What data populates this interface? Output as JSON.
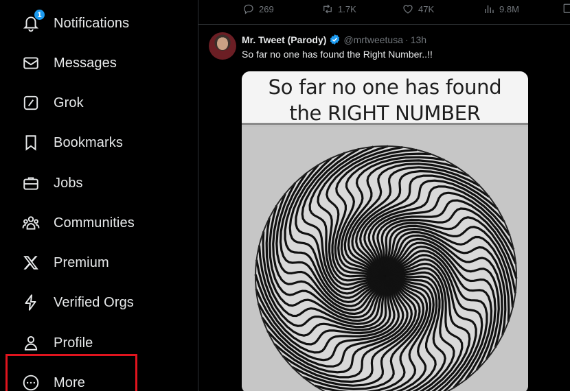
{
  "sidebar": {
    "items": [
      {
        "label": "Notifications",
        "icon": "bell-icon",
        "badge": "1"
      },
      {
        "label": "Messages",
        "icon": "envelope-icon"
      },
      {
        "label": "Grok",
        "icon": "grok-icon"
      },
      {
        "label": "Bookmarks",
        "icon": "bookmark-icon"
      },
      {
        "label": "Jobs",
        "icon": "briefcase-icon"
      },
      {
        "label": "Communities",
        "icon": "people-icon"
      },
      {
        "label": "Premium",
        "icon": "x-logo-icon"
      },
      {
        "label": "Verified Orgs",
        "icon": "lightning-icon"
      },
      {
        "label": "Profile",
        "icon": "person-icon"
      },
      {
        "label": "More",
        "icon": "more-circle-icon"
      }
    ]
  },
  "prev_tweet_actions": {
    "replies": "269",
    "reposts": "1.7K",
    "likes": "47K",
    "views": "9.8M"
  },
  "tweet": {
    "name": "Mr. Tweet (Parody)",
    "handle": "@mrtweetusa",
    "separator": "·",
    "time": "13h",
    "text": "So far no one has found the Right Number..!!",
    "media_caption_line1": "So far no one has found",
    "media_caption_line2": "the RIGHT NUMBER"
  },
  "colors": {
    "accent": "#1d9bf0",
    "highlight_box": "#e0141e",
    "muted": "#71767b"
  }
}
